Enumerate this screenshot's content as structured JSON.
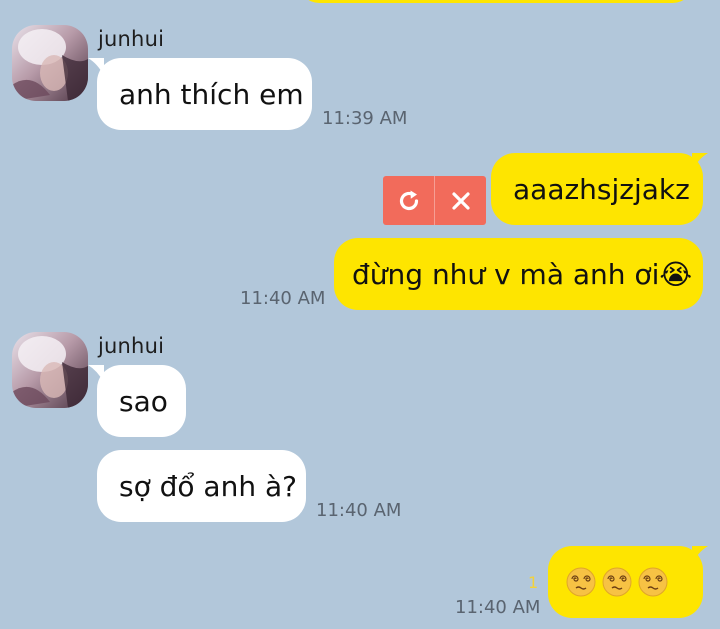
{
  "conversation": {
    "messages": [
      {
        "sender": "junhui",
        "text": "anh thích em",
        "time": "11:39 AM"
      },
      {
        "text": "aaazhsjzjakz",
        "status": "failed"
      },
      {
        "text": "đừng như v mà anh ơi😭",
        "time": "11:40 AM"
      },
      {
        "sender": "junhui",
        "text": "sao"
      },
      {
        "text": "sợ đổ anh à?",
        "time": "11:40 AM"
      },
      {
        "text": "😵‍💫😵‍💫😵‍💫",
        "time": "11:40 AM",
        "unread_count": "1"
      }
    ],
    "failed_actions": {
      "retry_icon": "retry-icon",
      "delete_icon": "close-icon"
    }
  },
  "colors": {
    "background": "#b2c7da",
    "incoming_bubble": "#ffffff",
    "outgoing_bubble": "#fee500",
    "failed_action": "#f26b5b",
    "unread_count": "#f3d23a"
  }
}
